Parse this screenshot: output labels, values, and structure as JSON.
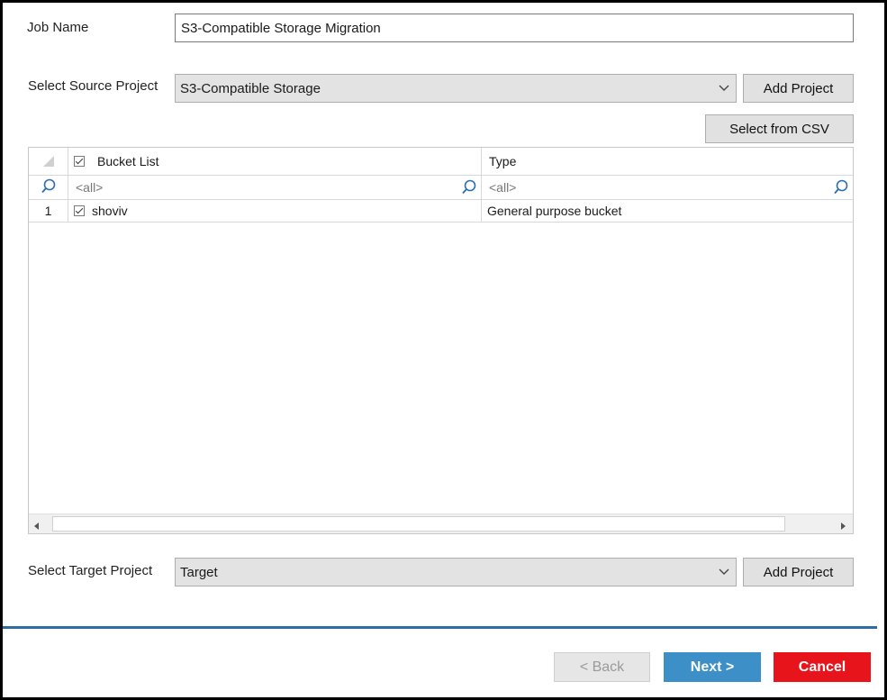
{
  "job_name": {
    "label": "Job Name",
    "value": "S3-Compatible Storage Migration"
  },
  "source": {
    "label": "Select Source Project",
    "value": "S3-Compatible Storage",
    "add_label": "Add Project",
    "csv_label": "Select from CSV"
  },
  "grid": {
    "columns": [
      "Bucket List",
      "Type"
    ],
    "filters": [
      "<all>",
      "<all>"
    ],
    "rows": [
      {
        "num": "1",
        "name": "shoviv",
        "type": "General purpose bucket"
      }
    ]
  },
  "target": {
    "label": "Select Target Project",
    "value": "Target",
    "add_label": "Add Project"
  },
  "nav": {
    "back_label": "< Back",
    "next_label": "Next >",
    "cancel_label": "Cancel"
  },
  "colors": {
    "next": "#3d8fc7",
    "cancel": "#e8141c",
    "divider": "#2e6e9e"
  }
}
